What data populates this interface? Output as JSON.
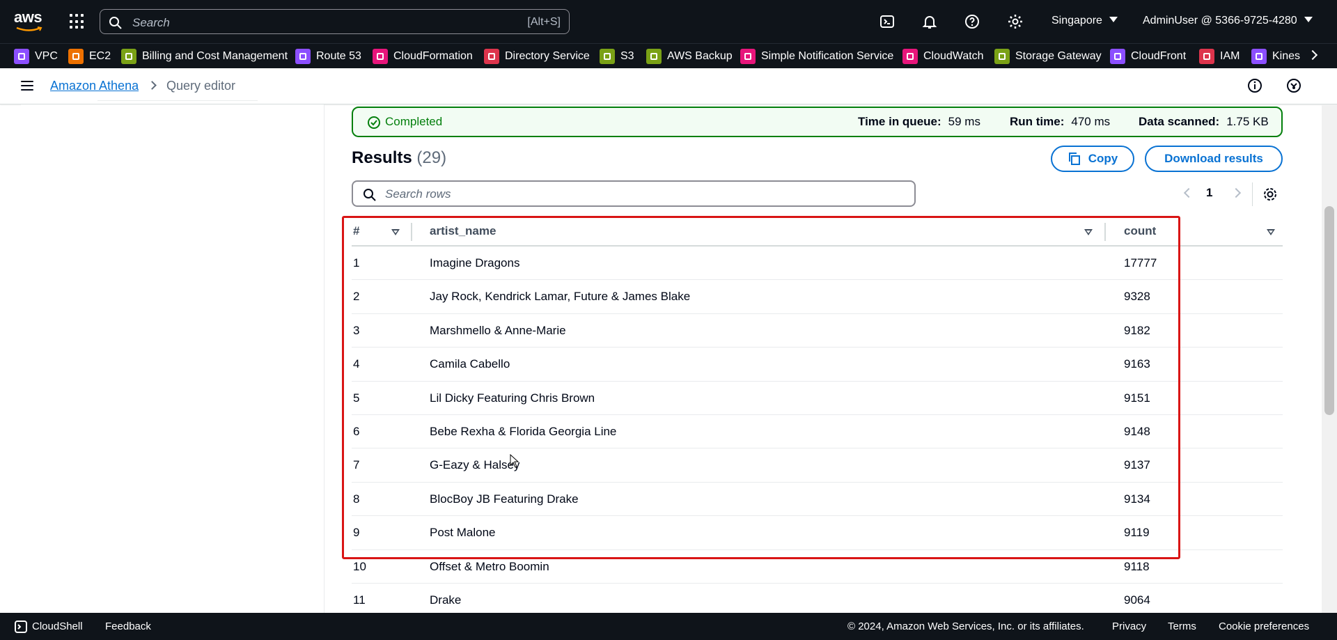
{
  "topnav": {
    "search_placeholder": "Search",
    "search_shortcut": "[Alt+S]",
    "region": "Singapore",
    "account": "AdminUser @ 5366-9725-4280"
  },
  "favorites": [
    {
      "label": "VPC",
      "color": "#8c4fff"
    },
    {
      "label": "EC2",
      "color": "#ed7100"
    },
    {
      "label": "Billing and Cost Management",
      "color": "#7aa116"
    },
    {
      "label": "Route 53",
      "color": "#8c4fff"
    },
    {
      "label": "CloudFormation",
      "color": "#e7157b"
    },
    {
      "label": "Directory Service",
      "color": "#dd344c"
    },
    {
      "label": "S3",
      "color": "#7aa116"
    },
    {
      "label": "AWS Backup",
      "color": "#7aa116"
    },
    {
      "label": "Simple Notification Service",
      "color": "#e7157b"
    },
    {
      "label": "CloudWatch",
      "color": "#e7157b"
    },
    {
      "label": "Storage Gateway",
      "color": "#7aa116"
    },
    {
      "label": "CloudFront",
      "color": "#8c4fff"
    },
    {
      "label": "IAM",
      "color": "#dd344c"
    },
    {
      "label": "Kines",
      "color": "#8c4fff"
    }
  ],
  "breadcrumb": {
    "parent": "Amazon Athena",
    "current": "Query editor"
  },
  "status": {
    "state": "Completed",
    "time_in_queue_label": "Time in queue:",
    "time_in_queue": "59 ms",
    "run_time_label": "Run time:",
    "run_time": "470 ms",
    "data_scanned_label": "Data scanned:",
    "data_scanned": "1.75 KB"
  },
  "results": {
    "title": "Results",
    "count": "(29)",
    "copy_label": "Copy",
    "download_label": "Download results",
    "search_placeholder": "Search rows",
    "page": "1"
  },
  "table": {
    "columns": [
      "#",
      "artist_name",
      "count"
    ],
    "rows": [
      [
        "1",
        "Imagine Dragons",
        "17777"
      ],
      [
        "2",
        "Jay Rock, Kendrick Lamar, Future & James Blake",
        "9328"
      ],
      [
        "3",
        "Marshmello & Anne-Marie",
        "9182"
      ],
      [
        "4",
        "Camila Cabello",
        "9163"
      ],
      [
        "5",
        "Lil Dicky Featuring Chris Brown",
        "9151"
      ],
      [
        "6",
        "Bebe Rexha & Florida Georgia Line",
        "9148"
      ],
      [
        "7",
        "G-Eazy & Halsey",
        "9137"
      ],
      [
        "8",
        "BlocBoy JB Featuring Drake",
        "9134"
      ],
      [
        "9",
        "Post Malone",
        "9119"
      ],
      [
        "10",
        "Offset & Metro Boomin",
        "9118"
      ],
      [
        "11",
        "Drake",
        "9064"
      ]
    ]
  },
  "footer": {
    "cloudshell": "CloudShell",
    "feedback": "Feedback",
    "copyright": "© 2024, Amazon Web Services, Inc. or its affiliates.",
    "privacy": "Privacy",
    "terms": "Terms",
    "cookies": "Cookie preferences"
  },
  "colors": {
    "nav_bg": "#0f141a",
    "link": "#0972d3",
    "success": "#037f0c",
    "highlight": "#d91515"
  }
}
